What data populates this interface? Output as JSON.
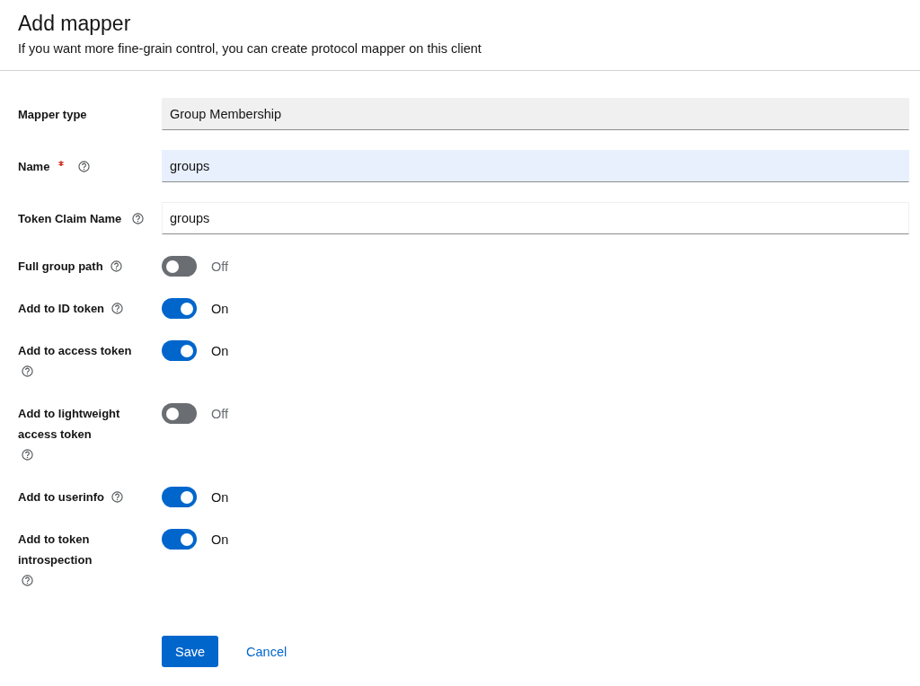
{
  "header": {
    "title": "Add mapper",
    "subtitle": "If you want more fine-grain control, you can create protocol mapper on this client"
  },
  "fields": [
    {
      "label": "Mapper type",
      "kind": "readonly",
      "required": false,
      "help": false,
      "value": "Group Membership"
    },
    {
      "label": "Name",
      "kind": "autofill",
      "required": true,
      "help": true,
      "value": "groups"
    },
    {
      "label": "Token Claim Name",
      "kind": "text",
      "required": false,
      "help": true,
      "value": "groups"
    }
  ],
  "switches": [
    {
      "label": "Full group path",
      "on": false,
      "state_text": "Off"
    },
    {
      "label": "Add to ID token",
      "on": true,
      "state_text": "On"
    },
    {
      "label": "Add to access token",
      "on": true,
      "state_text": "On"
    },
    {
      "label": "Add to lightweight access token",
      "on": false,
      "state_text": "Off"
    },
    {
      "label": "Add to userinfo",
      "on": true,
      "state_text": "On"
    },
    {
      "label": "Add to token introspection",
      "on": true,
      "state_text": "On"
    }
  ],
  "actions": {
    "primary": "Save",
    "link": "Cancel"
  }
}
